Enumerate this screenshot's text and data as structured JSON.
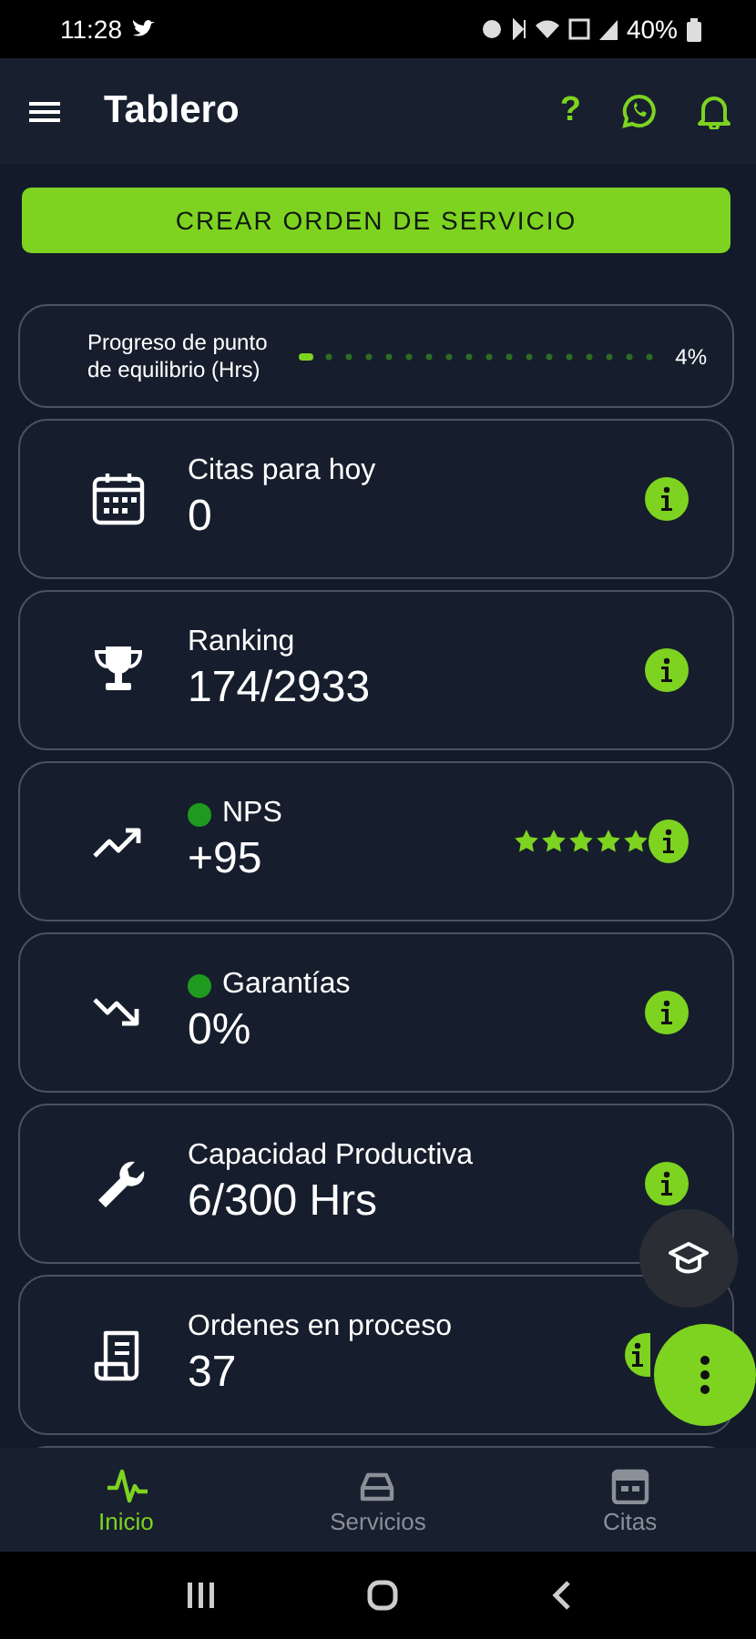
{
  "status_bar": {
    "time": "11:28",
    "battery": "40%"
  },
  "app_bar": {
    "title": "Tablero",
    "help": "?"
  },
  "create_button": {
    "label": "CREAR ORDEN DE SERVICIO"
  },
  "progress": {
    "label": "Progreso de punto de equilibrio (Hrs)",
    "level": 0.04,
    "reading": "4%"
  },
  "cards": [
    {
      "title": "Citas para hoy",
      "value": "0"
    },
    {
      "title": "Ranking",
      "value": "174/2933"
    },
    {
      "title": "NPS",
      "value": "+95",
      "color": "#1f9a1f",
      "stars": 5
    },
    {
      "title": "Garantías",
      "value": "0%",
      "color": "#1f9a1f"
    },
    {
      "title": "Capacidad Productiva",
      "value": "6/300 Hrs"
    },
    {
      "title": "Ordenes en proceso",
      "value": "37"
    }
  ],
  "bottom_nav": [
    {
      "label": "Inicio",
      "selected": true
    },
    {
      "label": "Servicios",
      "selected": false
    },
    {
      "label": "Citas",
      "selected": false
    }
  ]
}
